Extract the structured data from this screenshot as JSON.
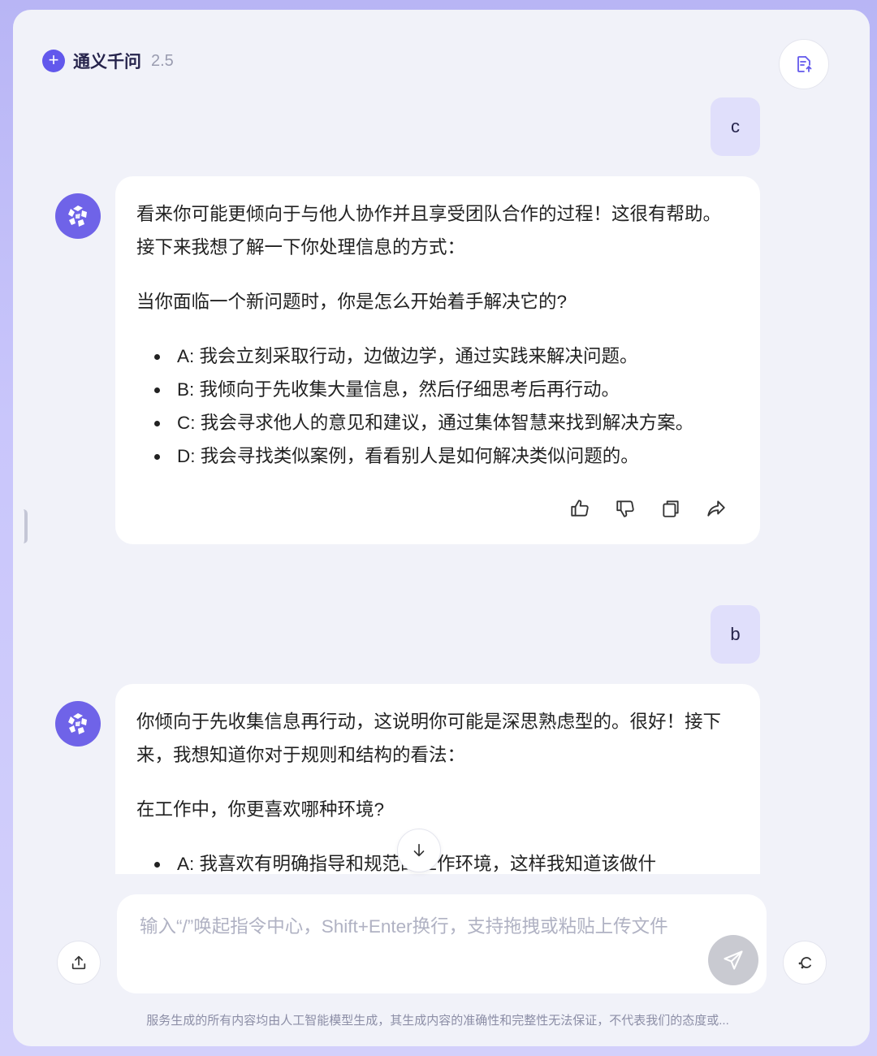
{
  "header": {
    "new_chat_icon": "plus-icon",
    "app_name": "通义千问",
    "version": "2.5",
    "doc_icon": "document-upload-icon"
  },
  "messages": [
    {
      "role": "user",
      "text": "c"
    },
    {
      "role": "assistant",
      "intro": "看来你可能更倾向于与他人协作并且享受团队合作的过程！这很有帮助。接下来我想了解一下你处理信息的方式：",
      "question": "当你面临一个新问题时，你是怎么开始着手解决它的?",
      "options": [
        "A: 我会立刻采取行动，边做边学，通过实践来解决问题。",
        "B: 我倾向于先收集大量信息，然后仔细思考后再行动。",
        "C: 我会寻求他人的意见和建议，通过集体智慧来找到解决方案。",
        "D: 我会寻找类似案例，看看别人是如何解决类似问题的。"
      ],
      "actions": [
        "thumbs-up-icon",
        "thumbs-down-icon",
        "copy-icon",
        "share-icon"
      ]
    },
    {
      "role": "user",
      "text": "b"
    },
    {
      "role": "assistant",
      "intro": "你倾向于先收集信息再行动，这说明你可能是深思熟虑型的。很好！接下来，我想知道你对于规则和结构的看法：",
      "question": "在工作中，你更喜欢哪种环境?",
      "options": [
        "A: 我喜欢有明确指导和规范的工作环境，这样我知道该做什"
      ]
    }
  ],
  "composer": {
    "placeholder": "输入“/”唤起指令中心，Shift+Enter换行，支持拖拽或粘贴上传文件",
    "send_icon": "send-icon",
    "upload_icon": "upload-icon",
    "more_icon": "tools-icon"
  },
  "scroll_icon": "arrow-down-icon",
  "disclaimer": "服务生成的所有内容均由人工智能模型生成，其生成内容的准确性和完整性无法保证，不代表我们的态度或..."
}
